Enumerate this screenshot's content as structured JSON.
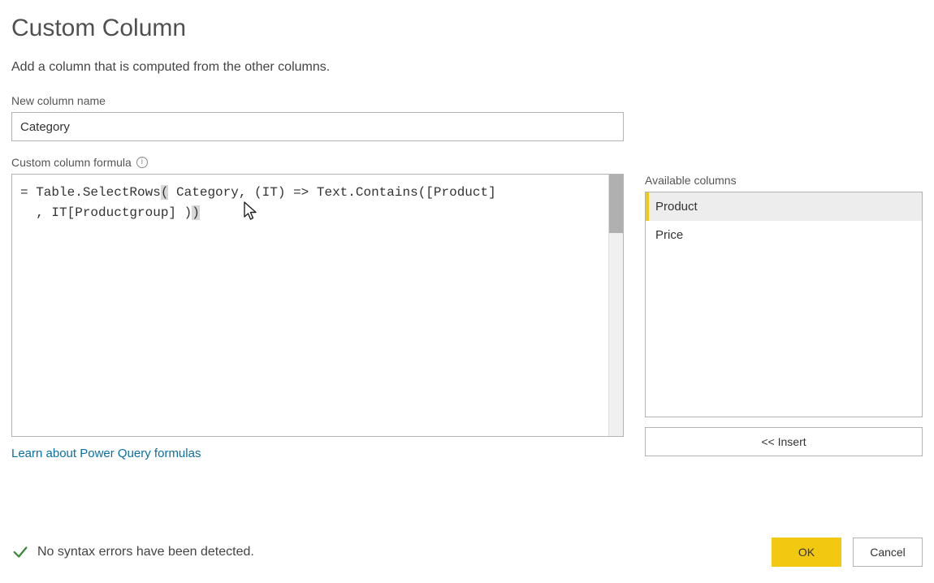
{
  "dialog": {
    "title": "Custom Column",
    "subtitle": "Add a column that is computed from the other columns."
  },
  "name_field": {
    "label": "New column name",
    "value": "Category"
  },
  "formula": {
    "label": "Custom column formula",
    "prefix": "= ",
    "part_func": "Table.SelectRows",
    "open_paren": "(",
    "inner1": " Category, (IT) => Text.Contains([Product]",
    "line2_indent": "  , IT[Productgroup] )",
    "close_paren": ")"
  },
  "available": {
    "label": "Available columns",
    "items": [
      "Product",
      "Price"
    ],
    "selected_index": 0,
    "insert_label": "<< Insert"
  },
  "link": {
    "label": "Learn about Power Query formulas"
  },
  "status": {
    "text": "No syntax errors have been detected."
  },
  "buttons": {
    "ok": "OK",
    "cancel": "Cancel"
  }
}
